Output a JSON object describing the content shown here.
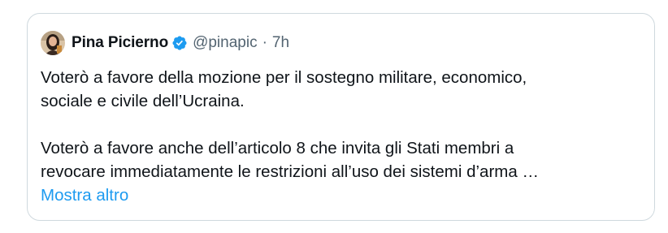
{
  "tweet": {
    "author_name": "Pina Picierno",
    "handle": "@pinapic",
    "separator": "·",
    "time": "7h",
    "verified_icon": "verified-badge-icon",
    "lines": [
      "Voterò a favore della mozione per il sostegno militare, economico,",
      "sociale e civile dell’Ucraina.",
      "Voterò a favore anche dell’articolo 8 che invita gli Stati membri a",
      "revocare immediatamente le restrizioni all’uso dei sistemi d’arma …"
    ],
    "show_more": "Mostra altro"
  },
  "colors": {
    "text": "#0f1419",
    "secondary": "#536471",
    "link": "#1d9bf0",
    "border": "#cfd9de",
    "verified": "#1d9bf0"
  }
}
